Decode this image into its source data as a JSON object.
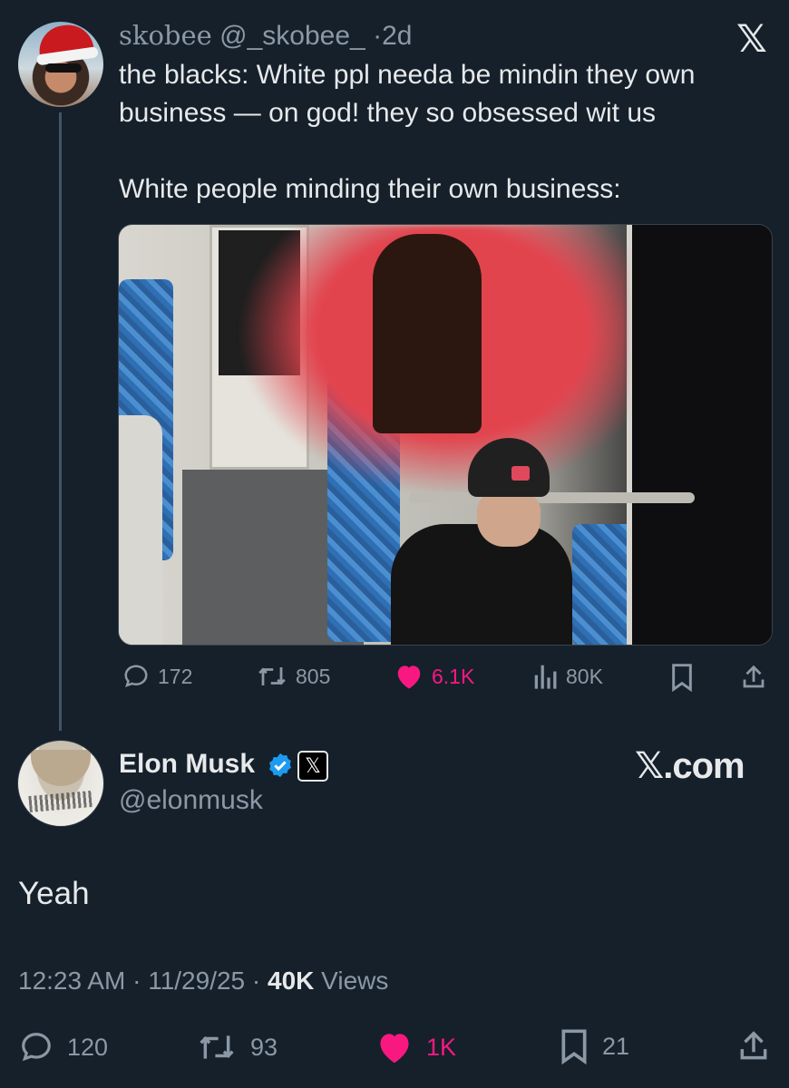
{
  "parent": {
    "name": "skobee",
    "handle": "@_skobee_",
    "separator": "·",
    "time": "2d",
    "text_line1": "the blacks: White ppl needa be mindin they own",
    "text_line2": "business — on god! they so obsessed wit us",
    "text_line3": "White people minding their own business:",
    "actions": {
      "replies": "172",
      "reposts": "805",
      "likes": "6.1K",
      "views": "80K"
    }
  },
  "top_logo": "𝕏",
  "main": {
    "name": "Elon Musk",
    "handle": "@elonmusk",
    "affiliate_badge": "𝕏",
    "brand_text": "𝕏.com",
    "text": "Yeah",
    "meta": {
      "time": "12:23 AM",
      "dot1": "·",
      "date": "11/29/25",
      "dot2": "·",
      "views_count": "40K",
      "views_label": "Views"
    },
    "actions": {
      "replies": "120",
      "reposts": "93",
      "likes": "1K",
      "bookmarks": "21"
    }
  },
  "colors": {
    "background": "#15202b",
    "text": "#e7e9ea",
    "muted": "#8b98a5",
    "like": "#f91880",
    "verified": "#1d9bf0"
  },
  "icons": [
    "reply-icon",
    "repost-icon",
    "heart-icon",
    "views-icon",
    "bookmark-icon",
    "share-icon",
    "verified-icon",
    "x-logo-icon"
  ]
}
